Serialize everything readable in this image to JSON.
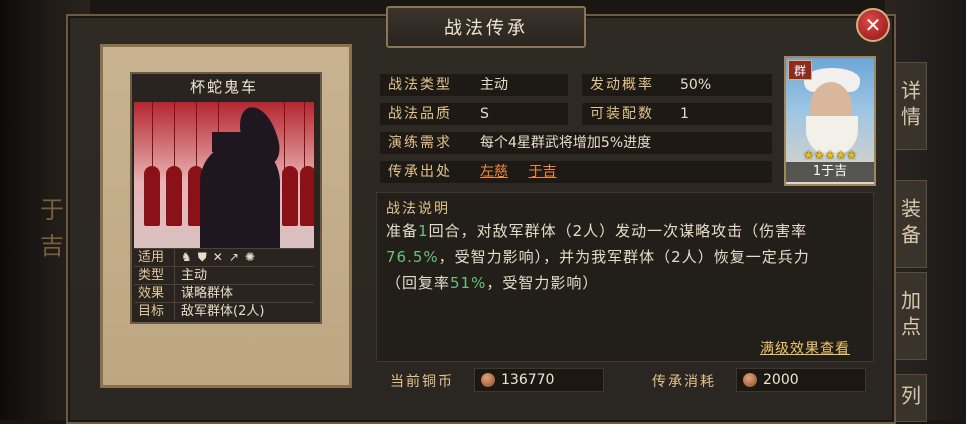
{
  "window": {
    "title": "战法传承",
    "close_icon": "close-icon"
  },
  "side": {
    "left_letters": [
      "于",
      "吉"
    ],
    "right_tabs": [
      "详情",
      "装备",
      "加点",
      "列"
    ]
  },
  "card": {
    "name": "杯蛇鬼车",
    "attrs": [
      {
        "key": "适用",
        "value": ""
      },
      {
        "key": "类型",
        "value": "主动"
      },
      {
        "key": "效果",
        "value": "谋略群体"
      },
      {
        "key": "目标",
        "value": "敌军群体(2人)"
      }
    ],
    "unit_icons": [
      "cavalry-icon",
      "shield-icon",
      "archer-icon",
      "spear-icon",
      "chariot-icon"
    ]
  },
  "info": {
    "type_label": "战法类型",
    "type_value": "主动",
    "rate_label": "发动概率",
    "rate_value": "50%",
    "quality_label": "战法品质",
    "quality_value": "S",
    "slots_label": "可装配数",
    "slots_value": "1",
    "train_label": "演练需求",
    "train_value": "每个4星群武将增加5%进度",
    "source_label": "传承出处",
    "source_values": [
      "左慈",
      "于吉"
    ]
  },
  "portrait": {
    "faction": "群",
    "stars": "★★★★★",
    "name": "1于吉"
  },
  "description": {
    "title": "战法说明",
    "line1_a": "准备",
    "line1_num": "1",
    "line1_b": "回合，对敌军群体（2人）发动一次谋略攻击（伤害率",
    "line2_num": "76.5%",
    "line2_b": "，受智力影响），并为我军群体（2人）恢复一定兵力",
    "line3_a": "（回复率",
    "line3_num": "51%",
    "line3_b": "，受智力影响）",
    "max_link": "满级效果查看"
  },
  "bottom": {
    "copper_label": "当前铜币",
    "copper_value": "136770",
    "cost_label": "传承消耗",
    "cost_value": "2000"
  }
}
